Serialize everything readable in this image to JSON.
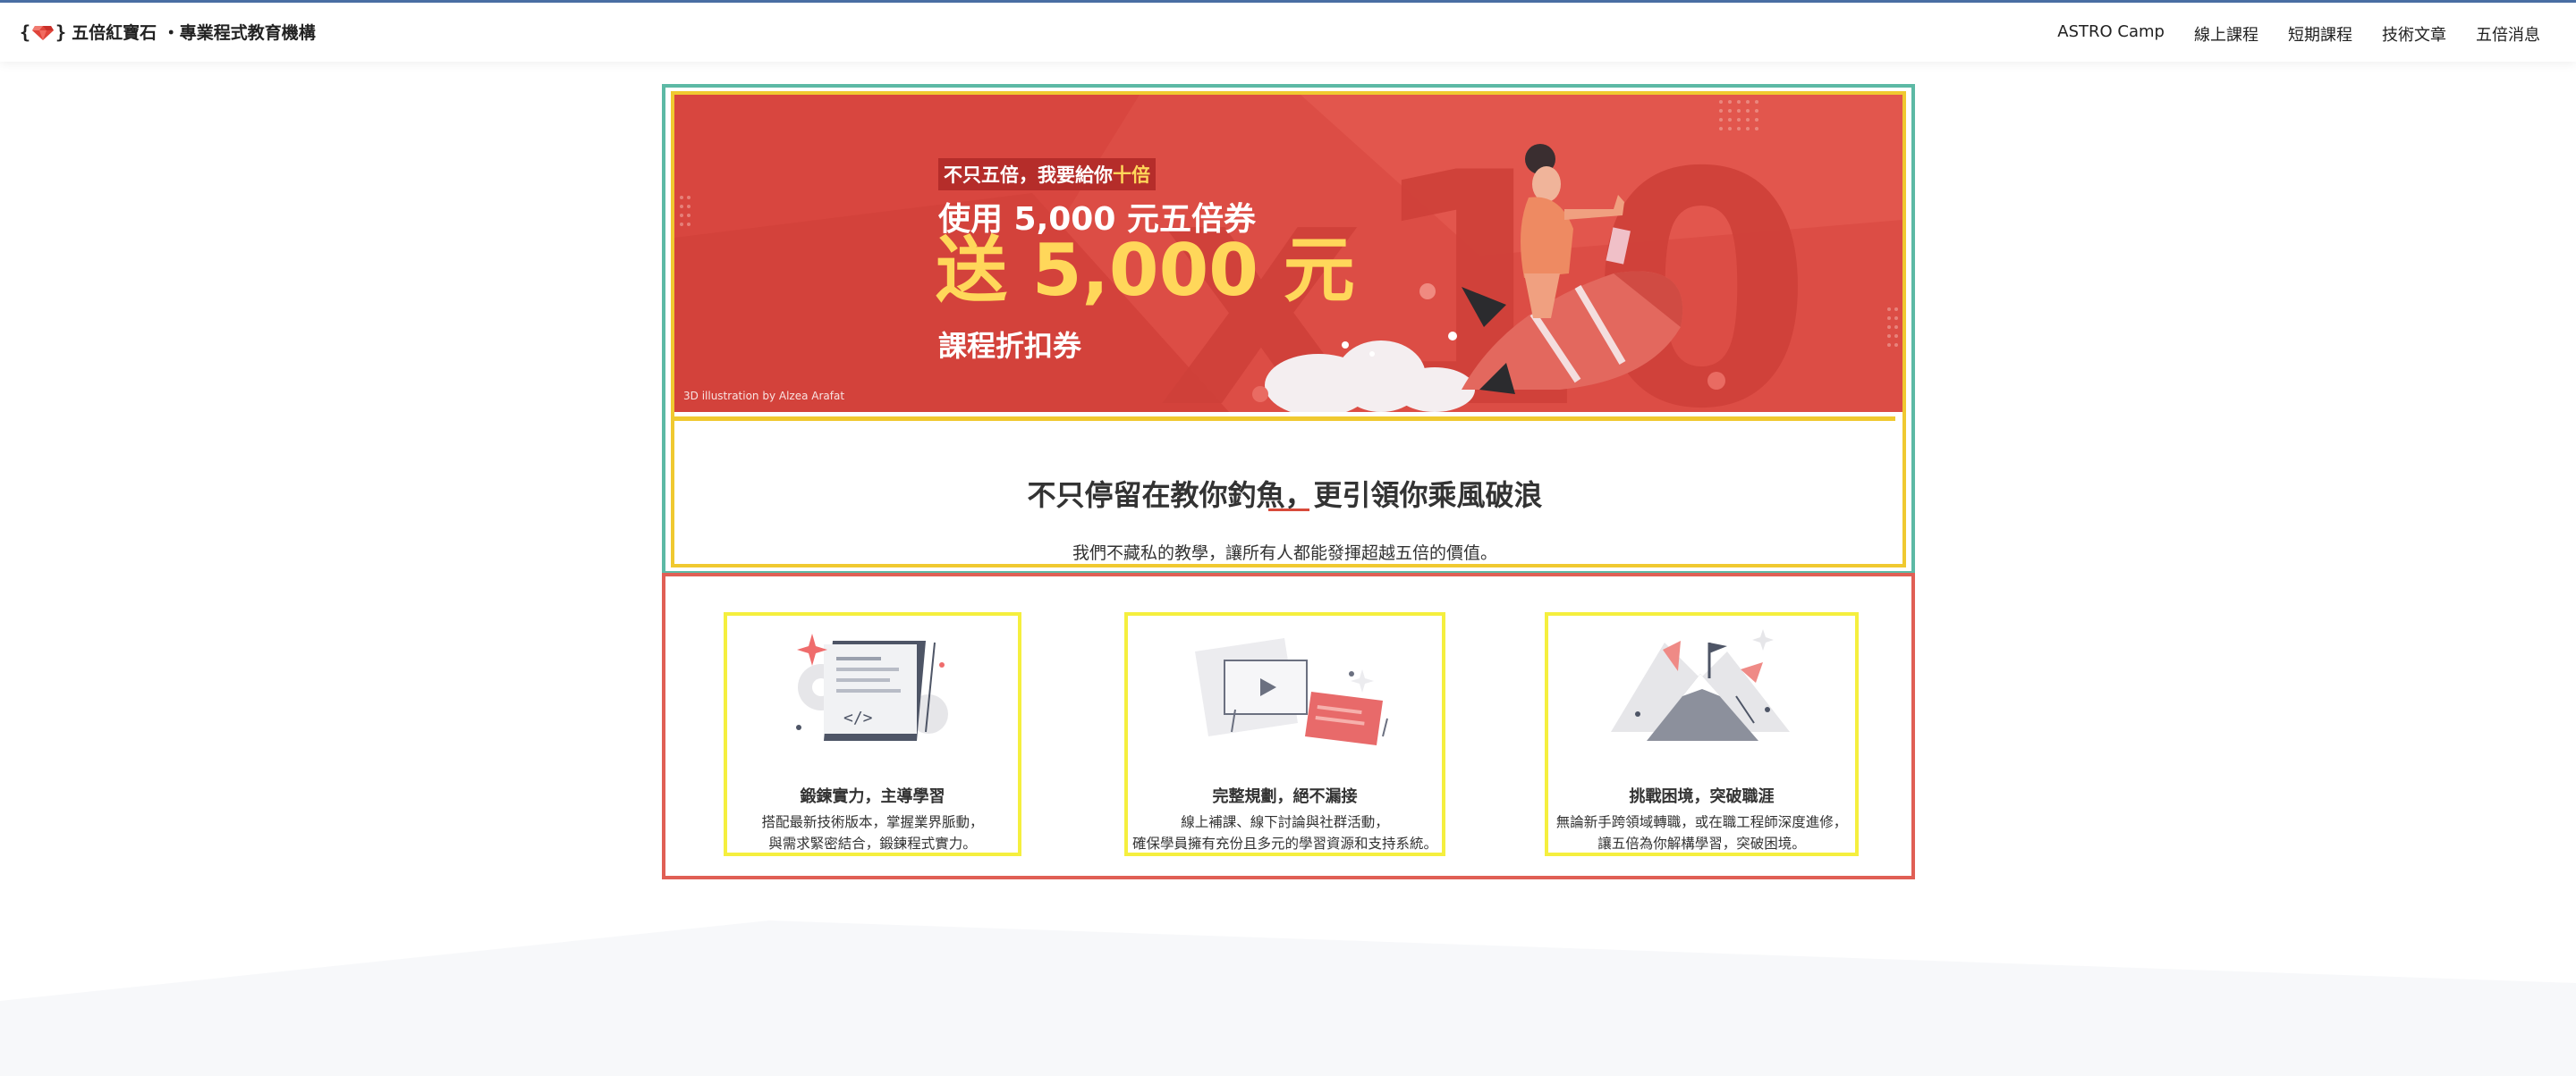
{
  "header": {
    "brand_open": "{",
    "brand_close": "}",
    "brand_name": "五倍紅寶石 ・專業程式教育機構",
    "nav": [
      "ASTRO Camp",
      "線上課程",
      "短期課程",
      "技術文章",
      "五倍消息"
    ]
  },
  "banner": {
    "tag_prefix": "不只五倍，我要給你",
    "tag_highlight": "十倍",
    "line2": "使用 5,000 元五倍券",
    "line3": "送 5,000 元",
    "line4": "課程折扣券",
    "credit": "3D illustration by Alzea Arafat"
  },
  "intro": {
    "heading": "不只停留在教你釣魚，更引領你乘風破浪",
    "subtext": "我們不藏私的教學，讓所有人都能發揮超越五倍的價值。"
  },
  "features": [
    {
      "title": "鍛鍊實力，主導學習",
      "desc1": "搭配最新技術版本，掌握業界脈動，",
      "desc2": "與需求緊密結合，鍛鍊程式實力。",
      "icon": "code-document-icon"
    },
    {
      "title": "完整規劃，絕不漏接",
      "desc1": "線上補課、線下討論與社群活動，",
      "desc2": "確保學員擁有充份且多元的學習資源和支持系統。",
      "icon": "video-chat-icon"
    },
    {
      "title": "挑戰困境，突破職涯",
      "desc1": "無論新手跨領域轉職，或在職工程師深度進修，",
      "desc2": "讓五倍為你解構學習，突破困境。",
      "icon": "mountain-flag-icon"
    }
  ],
  "colors": {
    "banner_red": "#dc4d45",
    "highlight_yellow": "#ffd75a",
    "accent_red": "#d84a3b"
  }
}
